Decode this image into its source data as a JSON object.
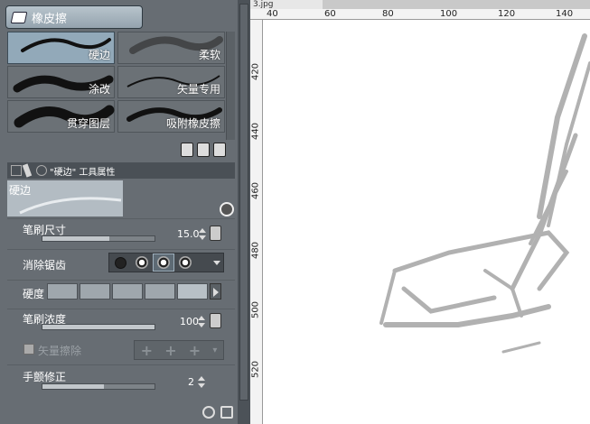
{
  "tool": {
    "name": "橡皮擦"
  },
  "brushes": [
    {
      "label": "硬边",
      "selected": true
    },
    {
      "label": "柔软",
      "selected": false
    },
    {
      "label": "涂改",
      "selected": false
    },
    {
      "label": "矢量专用",
      "selected": false
    },
    {
      "label": "贯穿图层",
      "selected": false
    },
    {
      "label": "吸附橡皮擦",
      "selected": false
    }
  ],
  "properties_header": {
    "title": "\"硬边\" 工具属性"
  },
  "preview": {
    "name": "硬边"
  },
  "props": {
    "brush_size": {
      "label": "笔刷尺寸",
      "value": "15.0",
      "fill": 0.6
    },
    "antialias": {
      "label": "消除锯齿",
      "selected_index": 2
    },
    "hardness": {
      "label": "硬度",
      "selected_index": 4
    },
    "brush_density": {
      "label": "笔刷浓度",
      "value": "100",
      "fill": 1.0
    },
    "vector_erase": {
      "label": "矢量擦除",
      "checked": true,
      "enabled": false
    },
    "stabilization": {
      "label": "手颤修正",
      "value": "2",
      "fill": 0.55
    }
  },
  "canvas": {
    "tab_name": "3.jpg",
    "h_ruler": [
      "40",
      "60",
      "80",
      "100",
      "120",
      "140"
    ],
    "v_ruler": [
      "420",
      "440",
      "460",
      "480",
      "500",
      "520"
    ]
  }
}
